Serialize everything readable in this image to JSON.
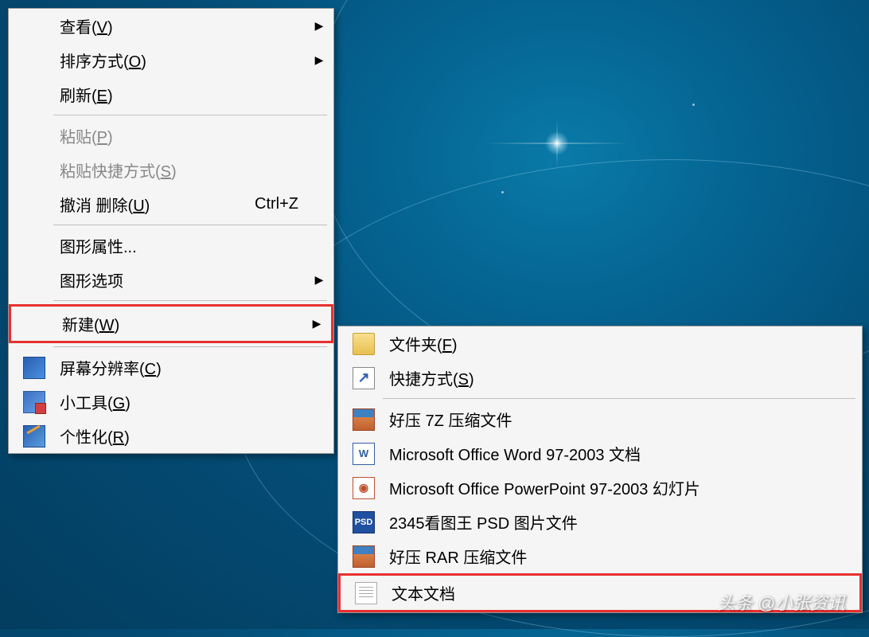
{
  "main_menu": {
    "items": [
      {
        "label": "查看(V)",
        "hotkey": "V",
        "has_submenu": true
      },
      {
        "label": "排序方式(O)",
        "hotkey": "O",
        "has_submenu": true
      },
      {
        "label": "刷新(E)",
        "hotkey": "E"
      },
      {
        "label": "粘贴(P)",
        "hotkey": "P",
        "disabled": true
      },
      {
        "label": "粘贴快捷方式(S)",
        "hotkey": "S",
        "disabled": true
      },
      {
        "label": "撤消 删除(U)",
        "hotkey": "U",
        "shortcut": "Ctrl+Z"
      },
      {
        "label": "图形属性..."
      },
      {
        "label": "图形选项",
        "has_submenu": true
      },
      {
        "label": "新建(W)",
        "hotkey": "W",
        "has_submenu": true,
        "highlighted": true
      },
      {
        "label": "屏幕分辨率(C)",
        "hotkey": "C",
        "icon": "screen"
      },
      {
        "label": "小工具(G)",
        "hotkey": "G",
        "icon": "gadget"
      },
      {
        "label": "个性化(R)",
        "hotkey": "R",
        "icon": "personalize"
      }
    ]
  },
  "submenu_new": {
    "items": [
      {
        "label": "文件夹(F)",
        "hotkey": "F",
        "icon": "folder"
      },
      {
        "label": "快捷方式(S)",
        "hotkey": "S",
        "icon": "shortcut"
      },
      {
        "label": "好压 7Z 压缩文件",
        "icon": "archive"
      },
      {
        "label": "Microsoft Office Word 97-2003 文档",
        "icon": "word"
      },
      {
        "label": "Microsoft Office PowerPoint 97-2003 幻灯片",
        "icon": "ppt"
      },
      {
        "label": "2345看图王 PSD 图片文件",
        "icon": "psd"
      },
      {
        "label": "好压 RAR 压缩文件",
        "icon": "archive"
      },
      {
        "label": "文本文档",
        "icon": "txt",
        "highlighted": true
      }
    ]
  },
  "watermark": "头条 @小张资讯"
}
